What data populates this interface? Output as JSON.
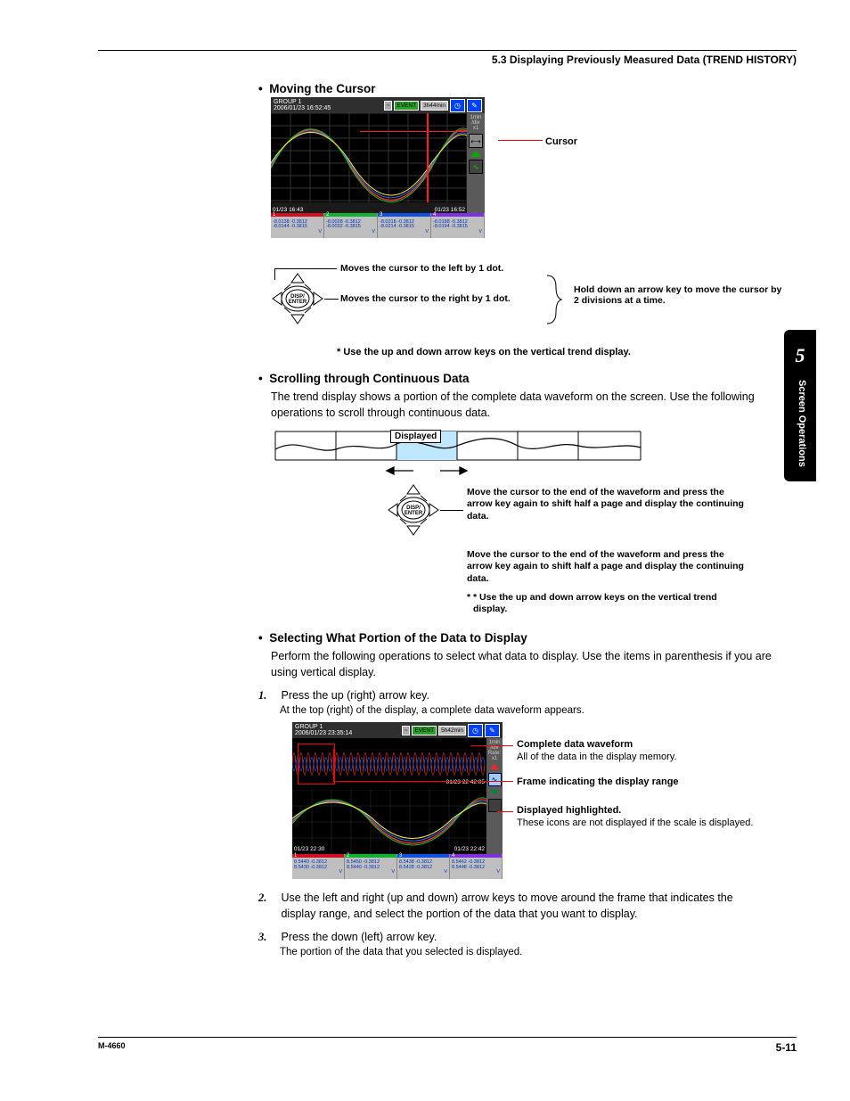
{
  "header": "5.3  Displaying Previously Measured Data (TREND HISTORY)",
  "tab": {
    "num": "5",
    "label": "Screen Operations"
  },
  "s1": {
    "title": "Moving the Cursor",
    "shot_hdr_group": "GROUP 1",
    "shot_hdr_time": "2006/01/23 16:52:45",
    "shot_hdr_event": "EVENT",
    "shot_hdr_range": "3h44min",
    "side_scale": "1min\n/div",
    "side_x": "x1",
    "time_left": "01/23 16:43",
    "time_right": "01/23 16:52",
    "ft": [
      {
        "n": "1",
        "a": "-8.0138",
        "b": "-0.3812",
        "c": "-8.0144",
        "d": "-0.3815",
        "u": "V"
      },
      {
        "n": "2",
        "a": "-8.0028",
        "b": "-0.3812",
        "c": "-8.0032",
        "d": "-0.3815",
        "u": "V"
      },
      {
        "n": "3",
        "a": "-8.0218",
        "b": "-0.3812",
        "c": "-8.0214",
        "d": "-0.3815",
        "u": "V"
      },
      {
        "n": "4",
        "a": "-8.0188",
        "b": "-0.3812",
        "c": "-8.0194",
        "d": "-0.3815",
        "u": "V"
      }
    ],
    "btn_label": "DISP/\nENTER",
    "cursor_label": "Cursor",
    "dp_left": "Moves the cursor to the left by 1 dot.",
    "dp_right": "Moves the cursor to the right by 1 dot.",
    "dp_hold": "Hold down an arrow key to move the cursor by 2 divisions at a time.",
    "note": "* Use the up and down arrow keys on the vertical trend display."
  },
  "s2": {
    "title": "Scrolling through Continuous Data",
    "body": "The trend display shows a portion of the complete data waveform on the screen. Use the following operations to scroll through continuous data.",
    "disp_label": "Displayed",
    "btn_label": "DISP/\nENTER",
    "txt_a": "Move the cursor to the end of the waveform and press the arrow key again to shift half a page and display the continuing data.",
    "txt_b": "Move the cursor to the end of the waveform and press the arrow key again to shift half a page and display the continuing data.",
    "txt_c": "* Use the up and down arrow keys on the vertical trend display."
  },
  "s3": {
    "title": "Selecting What Portion of the Data to Display",
    "body": "Perform the following operations to select what data to display. Use the items in parenthesis if you are using vertical display.",
    "step1_num": "1.",
    "step1": "Press the up (right) arrow key.",
    "step1_sub": "At the top (right) of the display, a complete data waveform appears.",
    "shot_hdr_group": "GROUP 1",
    "shot_hdr_time": "2006/01/23 23:35:14",
    "shot_hdr_event": "EVENT",
    "shot_hdr_range": "5h42min",
    "side_scale": "1min\n/div",
    "side_rate": "Rate:\nx1",
    "tm_ov": "01/23 22 42:05",
    "tm_l": "01/23 22:30",
    "tm_r": "01/23 22:42",
    "ft": [
      {
        "n": "1",
        "a": "8.5440",
        "b": "-0.3812",
        "c": "8.5430",
        "d": "-0.3812",
        "u": "V"
      },
      {
        "n": "2",
        "a": "8.5450",
        "b": "-0.3812",
        "c": "8.5440",
        "d": "-0.3812",
        "u": "V"
      },
      {
        "n": "3",
        "a": "8.5438",
        "b": "-0.3812",
        "c": "8.5428",
        "d": "-0.3812",
        "u": "V"
      },
      {
        "n": "4",
        "a": "8.5462",
        "b": "-0.3812",
        "c": "8.5448",
        "d": "-0.3812",
        "u": "V"
      }
    ],
    "c1_b": "Complete data waveform",
    "c1": "All of the data in the display memory.",
    "c2_b": "Frame indicating the display range",
    "c3_b": "Displayed highlighted.",
    "c3": "These icons are not displayed if the scale is displayed.",
    "step2_num": "2.",
    "step2": "Use the left and right (up and down) arrow keys to move around the frame that indicates the display range, and select the portion of the data that you want to display.",
    "step3_num": "3.",
    "step3": "Press the down (left) arrow key.",
    "step3_sub": "The portion of the data that you selected is displayed."
  },
  "footer": {
    "left": "M-4660",
    "right": "5-11"
  }
}
